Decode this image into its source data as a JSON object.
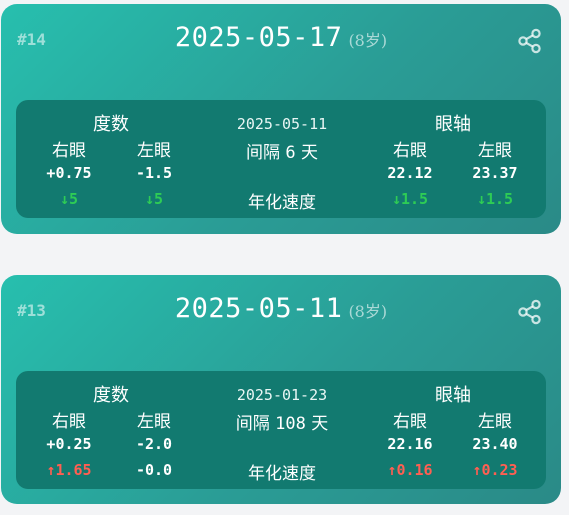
{
  "colors": {
    "green": "#2ecc55",
    "red": "#ff5f52"
  },
  "cards": [
    {
      "index": "#14",
      "date": "2025-05-17",
      "age": "(8岁)",
      "share_icon": "share-icon",
      "panel": {
        "degree_header": "度数",
        "axis_header": "眼轴",
        "right_eye": "右眼",
        "left_eye": "左眼",
        "prev_date": "2025-05-11",
        "gap_prefix": "间隔",
        "gap_days": "6",
        "gap_suffix": "天",
        "speed_label": "年化速度",
        "degree_right": "+0.75",
        "degree_left": "-1.5",
        "axis_right": "22.12",
        "axis_left": "23.37",
        "degree_right_rate": "↓5",
        "degree_left_rate": "↓5",
        "axis_right_rate": "↓1.5",
        "axis_left_rate": "↓1.5"
      }
    },
    {
      "index": "#13",
      "date": "2025-05-11",
      "age": "(8岁)",
      "share_icon": "share-icon",
      "panel": {
        "degree_header": "度数",
        "axis_header": "眼轴",
        "right_eye": "右眼",
        "left_eye": "左眼",
        "prev_date": "2025-01-23",
        "gap_prefix": "间隔",
        "gap_days": "108",
        "gap_suffix": "天",
        "speed_label": "年化速度",
        "degree_right": "+0.25",
        "degree_left": "-2.0",
        "axis_right": "22.16",
        "axis_left": "23.40",
        "degree_right_rate": "↑1.65",
        "degree_left_rate": "-0.0",
        "axis_right_rate": "↑0.16",
        "axis_left_rate": "↑0.23"
      }
    }
  ]
}
